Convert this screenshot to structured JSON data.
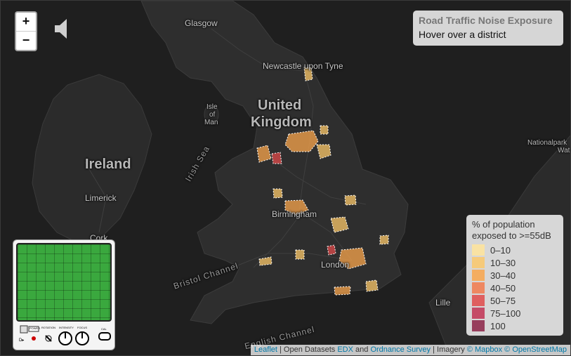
{
  "zoom": {
    "in_label": "+",
    "out_label": "−"
  },
  "info": {
    "title": "Road Traffic Noise Exposure",
    "subtitle": "Hover over a district"
  },
  "legend": {
    "title": "% of population exposed to >=55dB",
    "items": [
      {
        "label": "0–10",
        "color": "#ffe49a"
      },
      {
        "label": "10–30",
        "color": "#fcc86a"
      },
      {
        "label": "30–40",
        "color": "#f9a64c"
      },
      {
        "label": "40–50",
        "color": "#f27a4c"
      },
      {
        "label": "50–75",
        "color": "#e04a4a"
      },
      {
        "label": "75–100",
        "color": "#c23354"
      },
      {
        "label": "100",
        "color": "#8c2346"
      }
    ]
  },
  "places": {
    "glasgow": "Glasgow",
    "newcastle": "Newcastle upon Tyne",
    "united_kingdom_1": "United",
    "united_kingdom_2": "Kingdom",
    "isle_of_man_1": "Isle",
    "isle_of_man_2": "of",
    "isle_of_man_3": "Man",
    "ireland": "Ireland",
    "limerick": "Limerick",
    "cork": "Cork",
    "birmingham": "Birmingham",
    "london": "London",
    "irish_sea": "Irish Sea",
    "bristol_channel": "Bristol Channel",
    "english_channel": "English Channel",
    "lille": "Lille",
    "nationalpark_1": "Nationalpark",
    "nationalpark_2": "Wat"
  },
  "attribution": {
    "leaflet": "Leaflet",
    "open_datasets": " | Open Datasets ",
    "edx": "EDX",
    "and": " and ",
    "os": "Ordnance Survey",
    "imagery": " | Imagery ",
    "mapbox": "© Mapbox",
    "osm": "© OpenStreetMap"
  },
  "scope_labels": {
    "power": "POWER",
    "rotation": "ROTATION",
    "intensity": "INTENSITY",
    "focus": "FOCUS",
    "cal": "CAL"
  },
  "icons": {
    "speaker": "speaker-icon"
  }
}
